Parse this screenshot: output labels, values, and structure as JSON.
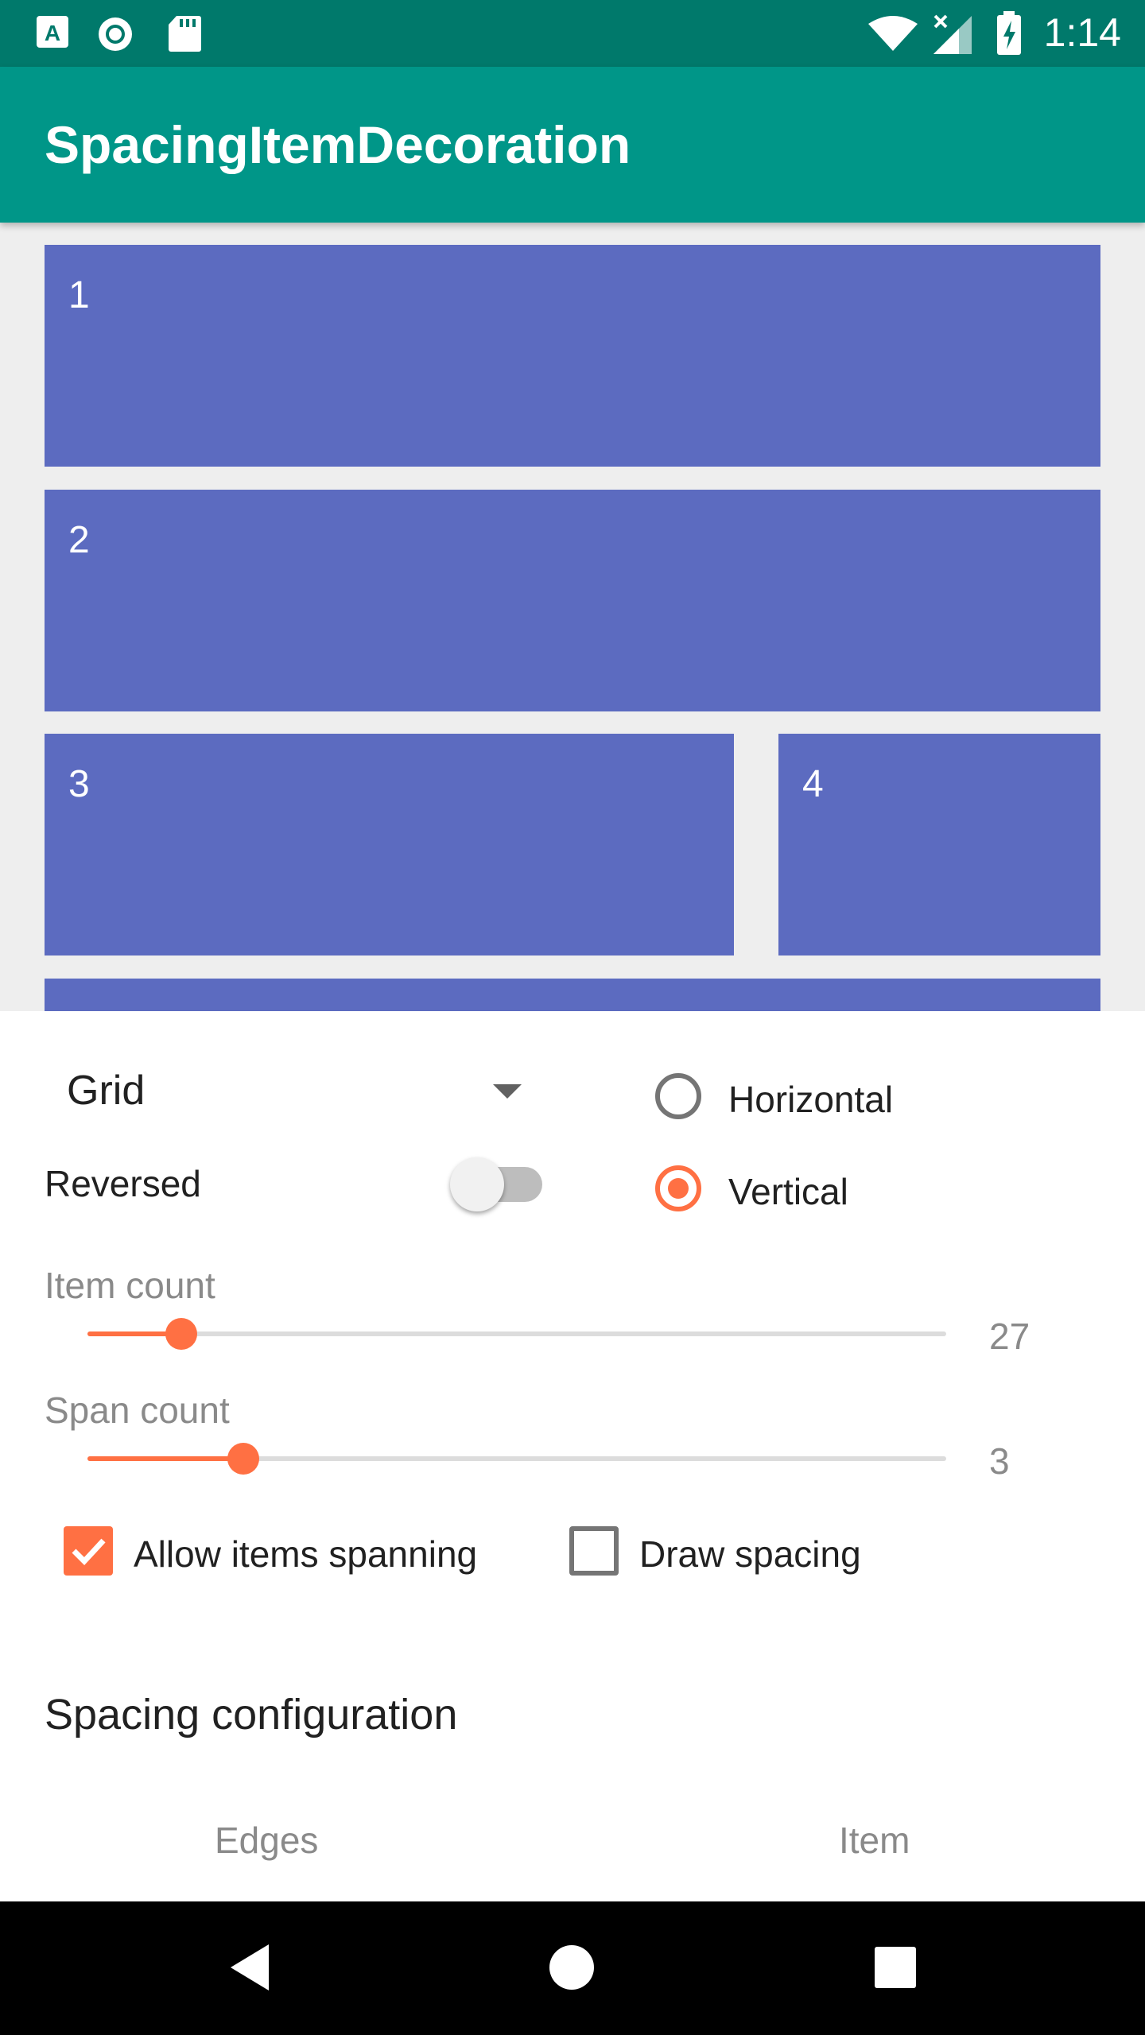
{
  "status_bar": {
    "time": "1:14",
    "icons_left": [
      "a-icon",
      "sync-icon",
      "sd-card-icon"
    ],
    "icons_right": [
      "wifi-icon",
      "signal-icon",
      "battery-charging-icon"
    ]
  },
  "app_bar": {
    "title": "SpacingItemDecoration"
  },
  "grid_items": [
    "1",
    "2",
    "3",
    "4",
    ""
  ],
  "controls": {
    "layout_type": "Grid",
    "reversed_label": "Reversed",
    "reversed_on": false,
    "orientation": {
      "horizontal_label": "Horizontal",
      "vertical_label": "Vertical",
      "selected": "Vertical"
    },
    "item_count": {
      "label": "Item count",
      "value": "27",
      "fraction": 0.11
    },
    "span_count": {
      "label": "Span count",
      "value": "3",
      "fraction": 0.18
    },
    "allow_spanning": {
      "label": "Allow items spanning",
      "checked": true
    },
    "draw_spacing": {
      "label": "Draw spacing",
      "checked": false
    }
  },
  "spacing_config": {
    "title": "Spacing configuration",
    "edges_label": "Edges",
    "item_label": "Item"
  },
  "nav_bar": {
    "icons": [
      "back-icon",
      "home-icon",
      "recents-icon"
    ]
  },
  "colors": {
    "primary": "#009688",
    "primary_dark": "#00796b",
    "accent": "#ff7043",
    "tile": "#5c6bc0"
  }
}
